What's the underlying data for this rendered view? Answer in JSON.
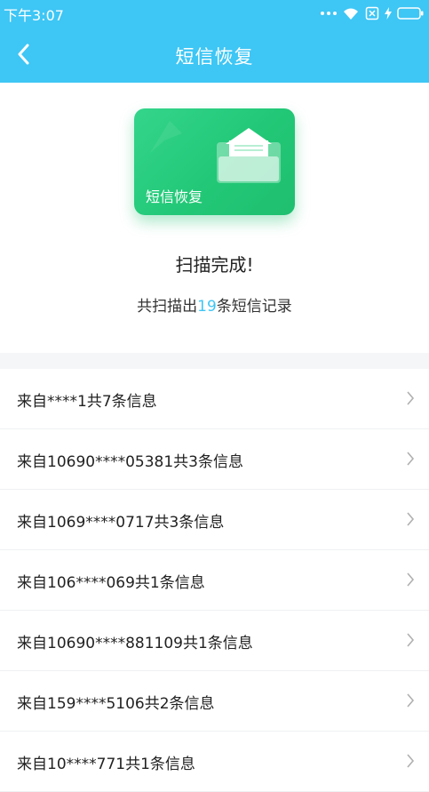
{
  "status": {
    "time": "下午3:07"
  },
  "nav": {
    "title": "短信恢复"
  },
  "hero": {
    "card_label": "短信恢复",
    "title": "扫描完成!",
    "summary_prefix": "共扫描出",
    "summary_count": "19",
    "summary_suffix": "条短信记录"
  },
  "records": [
    {
      "label": "来自****1共7条信息"
    },
    {
      "label": "来自10690****05381共3条信息"
    },
    {
      "label": "来自1069****0717共3条信息"
    },
    {
      "label": "来自106****069共1条信息"
    },
    {
      "label": "来自10690****881109共1条信息"
    },
    {
      "label": "来自159****5106共2条信息"
    },
    {
      "label": "来自10****771共1条信息"
    }
  ],
  "colors": {
    "accent": "#3ec6f5",
    "card_green": "#22c877"
  }
}
